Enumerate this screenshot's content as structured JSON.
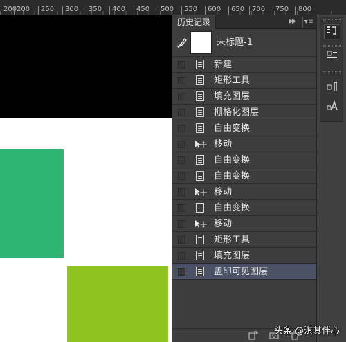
{
  "ruler": {
    "labels": [
      "200",
      "250",
      "300",
      "350",
      "400",
      "450",
      "500",
      "550",
      "600",
      "650",
      "700",
      "750",
      "800"
    ]
  },
  "canvas": {
    "colors": {
      "background": "#ffffff",
      "black_band": "#000000",
      "green_rect": "#2fb573",
      "lime_rect": "#8fc31f"
    }
  },
  "history_panel": {
    "tab_title": "历史记录",
    "collapse_icon": "double-chevron-right-icon",
    "menu_icon": "panel-menu-icon",
    "snapshot": {
      "name": "未标题-1",
      "icon": "history-brush-icon"
    },
    "items": [
      {
        "label": "新建",
        "icon": "document-icon",
        "selected": false
      },
      {
        "label": "矩形工具",
        "icon": "document-icon",
        "selected": false
      },
      {
        "label": "填充图层",
        "icon": "document-icon",
        "selected": false
      },
      {
        "label": "栅格化图层",
        "icon": "document-icon",
        "selected": false
      },
      {
        "label": "自由变换",
        "icon": "document-icon",
        "selected": false
      },
      {
        "label": "移动",
        "icon": "move-icon",
        "selected": false
      },
      {
        "label": "自由变换",
        "icon": "document-icon",
        "selected": false
      },
      {
        "label": "自由变换",
        "icon": "document-icon",
        "selected": false
      },
      {
        "label": "移动",
        "icon": "move-icon",
        "selected": false
      },
      {
        "label": "自由变换",
        "icon": "document-icon",
        "selected": false
      },
      {
        "label": "移动",
        "icon": "move-icon",
        "selected": false
      },
      {
        "label": "矩形工具",
        "icon": "document-icon",
        "selected": false
      },
      {
        "label": "填充图层",
        "icon": "document-icon",
        "selected": false
      },
      {
        "label": "盖印可见图层",
        "icon": "document-icon",
        "selected": true
      }
    ],
    "footer_icons": [
      "new-document-from-state-icon",
      "snapshot-camera-icon",
      "delete-trash-icon"
    ],
    "colors": {
      "panel": "#3d3d3d",
      "selected_row": "#4b5265",
      "text": "#e6e6e6"
    }
  },
  "dock": {
    "tools": [
      "history-panel-icon",
      "properties-panel-icon",
      "paragraph-panel-icon",
      "character-panel-icon"
    ]
  },
  "watermark": "头条 @淇其伴心"
}
